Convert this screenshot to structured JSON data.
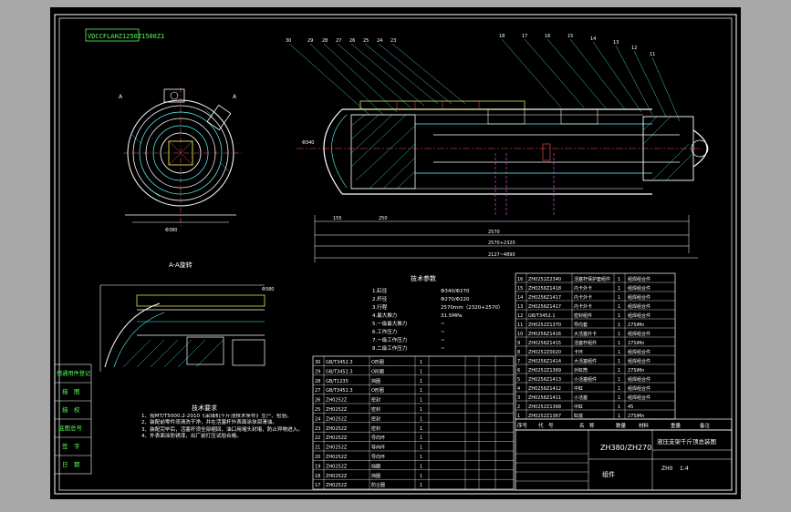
{
  "title_strip": "VDCCFLAHZ1250Z1500Z1",
  "section_label": "A-A旋转",
  "tech_params": {
    "heading": "技术参数",
    "rows": [
      "1.缸径",
      "2.杆径",
      "3.行程",
      "4.最大推力",
      "5.一级最大推力",
      "6.工作压力",
      "7.一级工作压力",
      "8.二级工作压力"
    ],
    "values": [
      "Φ340/Φ270",
      "Φ270/Φ220",
      "2570mm（2320+2570）",
      "31.5MPa",
      "~",
      "~",
      "~",
      "~"
    ]
  },
  "tech_requirements": {
    "heading": "技术要求",
    "items": [
      "1、按MT/T5000.2-2010《采煤机千斤顶技术条件》生产、检验。",
      "2、装配前零件须清洗干净，并在活塞杆外表面涂抹润滑油。",
      "3、装配完毕后，活塞杆须全部缩回，油口用堵头封堵，防止异物进入。",
      "4、外表面涂防锈漆，出厂前打压试验合格。"
    ]
  },
  "left_side_labels": [
    "借通用件登记",
    "描　图",
    "描　校",
    "底图总号",
    "签　字",
    "日　期"
  ],
  "bom_upper": {
    "rows": [
      {
        "no": "16",
        "code": "ZH0252Z2340",
        "name": "活塞杆保护套组件",
        "qty": "1",
        "mat": "组焊组合件"
      },
      {
        "no": "15",
        "code": "ZH0256Z1418",
        "name": "内卡外卡",
        "qty": "1",
        "mat": "组焊组合件"
      },
      {
        "no": "14",
        "code": "ZH0256Z1417",
        "name": "内卡外卡",
        "qty": "1",
        "mat": "组焊组合件"
      },
      {
        "no": "13",
        "code": "ZH0256Z1417",
        "name": "内卡外卡",
        "qty": "1",
        "mat": "组焊组合件"
      },
      {
        "no": "12",
        "code": "GB/T3452.1",
        "name": "密封组件",
        "qty": "1",
        "mat": "组焊组合件"
      },
      {
        "no": "11",
        "code": "ZH0252Z1370",
        "name": "导向套",
        "qty": "1",
        "mat": "27SiMn"
      },
      {
        "no": "10",
        "code": "ZH0256Z1416",
        "name": "大活塞外卡",
        "qty": "1",
        "mat": "组焊组合件"
      },
      {
        "no": "9",
        "code": "ZH0256Z1415",
        "name": "活塞杆组件",
        "qty": "1",
        "mat": "27SiMn"
      },
      {
        "no": "8",
        "code": "ZH0252Z0020",
        "name": "卡环",
        "qty": "1",
        "mat": "组焊组合件"
      },
      {
        "no": "7",
        "code": "ZH0256Z1414",
        "name": "大活塞组件",
        "qty": "1",
        "mat": "组焊组合件"
      },
      {
        "no": "6",
        "code": "ZH0252Z1369",
        "name": "外缸筒",
        "qty": "1",
        "mat": "27SiMn"
      },
      {
        "no": "5",
        "code": "ZH0256Z1413",
        "name": "小活塞组件",
        "qty": "1",
        "mat": "组焊组合件"
      },
      {
        "no": "4",
        "code": "ZH0256Z1412",
        "name": "中缸",
        "qty": "1",
        "mat": "组焊组合件"
      },
      {
        "no": "3",
        "code": "ZH0256Z1411",
        "name": "小活塞",
        "qty": "1",
        "mat": "组焊组合件"
      },
      {
        "no": "2",
        "code": "ZH0252Z1368",
        "name": "中缸",
        "qty": "1",
        "mat": "45"
      },
      {
        "no": "1",
        "code": "ZH0252Z1367",
        "name": "缸底",
        "qty": "1",
        "mat": "27SiMn"
      }
    ]
  },
  "bom_lower": {
    "rows": [
      {
        "no": "30",
        "code": "GB/T3452.3",
        "name": "O形圈",
        "qty": "1"
      },
      {
        "no": "29",
        "code": "GB/T3452.3",
        "name": "O形圈",
        "qty": "1"
      },
      {
        "no": "28",
        "code": "GB/T1235",
        "name": "挡圈",
        "qty": "1"
      },
      {
        "no": "27",
        "code": "GB/T3452.3",
        "name": "O形圈",
        "qty": "1"
      },
      {
        "no": "26",
        "code": "ZH0252Z",
        "name": "密封",
        "qty": "1"
      },
      {
        "no": "25",
        "code": "ZH0252Z",
        "name": "密封",
        "qty": "1"
      },
      {
        "no": "24",
        "code": "ZH0252Z",
        "name": "密封",
        "qty": "1"
      },
      {
        "no": "23",
        "code": "ZH0252Z",
        "name": "密封",
        "qty": "1"
      },
      {
        "no": "22",
        "code": "ZH0252Z",
        "name": "导向环",
        "qty": "1"
      },
      {
        "no": "21",
        "code": "ZH0252Z",
        "name": "导向环",
        "qty": "1"
      },
      {
        "no": "20",
        "code": "ZH0252Z",
        "name": "导向环",
        "qty": "1"
      },
      {
        "no": "19",
        "code": "ZH0252Z",
        "name": "挡圈",
        "qty": "1"
      },
      {
        "no": "18",
        "code": "ZH0252Z",
        "name": "挡圈",
        "qty": "1"
      },
      {
        "no": "17",
        "code": "ZH0252Z",
        "name": "防尘圈",
        "qty": "1"
      }
    ]
  },
  "title_block": {
    "header": [
      "序号",
      "代　号",
      "名　称",
      "数量",
      "材料",
      "重量",
      "备注"
    ],
    "model": "ZH380/ZH270",
    "product_name": "液压支架千斤顶总装图",
    "drawing_type": "组件",
    "scale": "1:4",
    "sheet": "ZH0"
  },
  "colors": {
    "background": "#a8a8a8",
    "sheet": "#000000",
    "frame": "#ffffff",
    "yellow": "#ffff55",
    "cyan": "#55ffff",
    "green": "#55ff55",
    "red": "#ff5555"
  }
}
